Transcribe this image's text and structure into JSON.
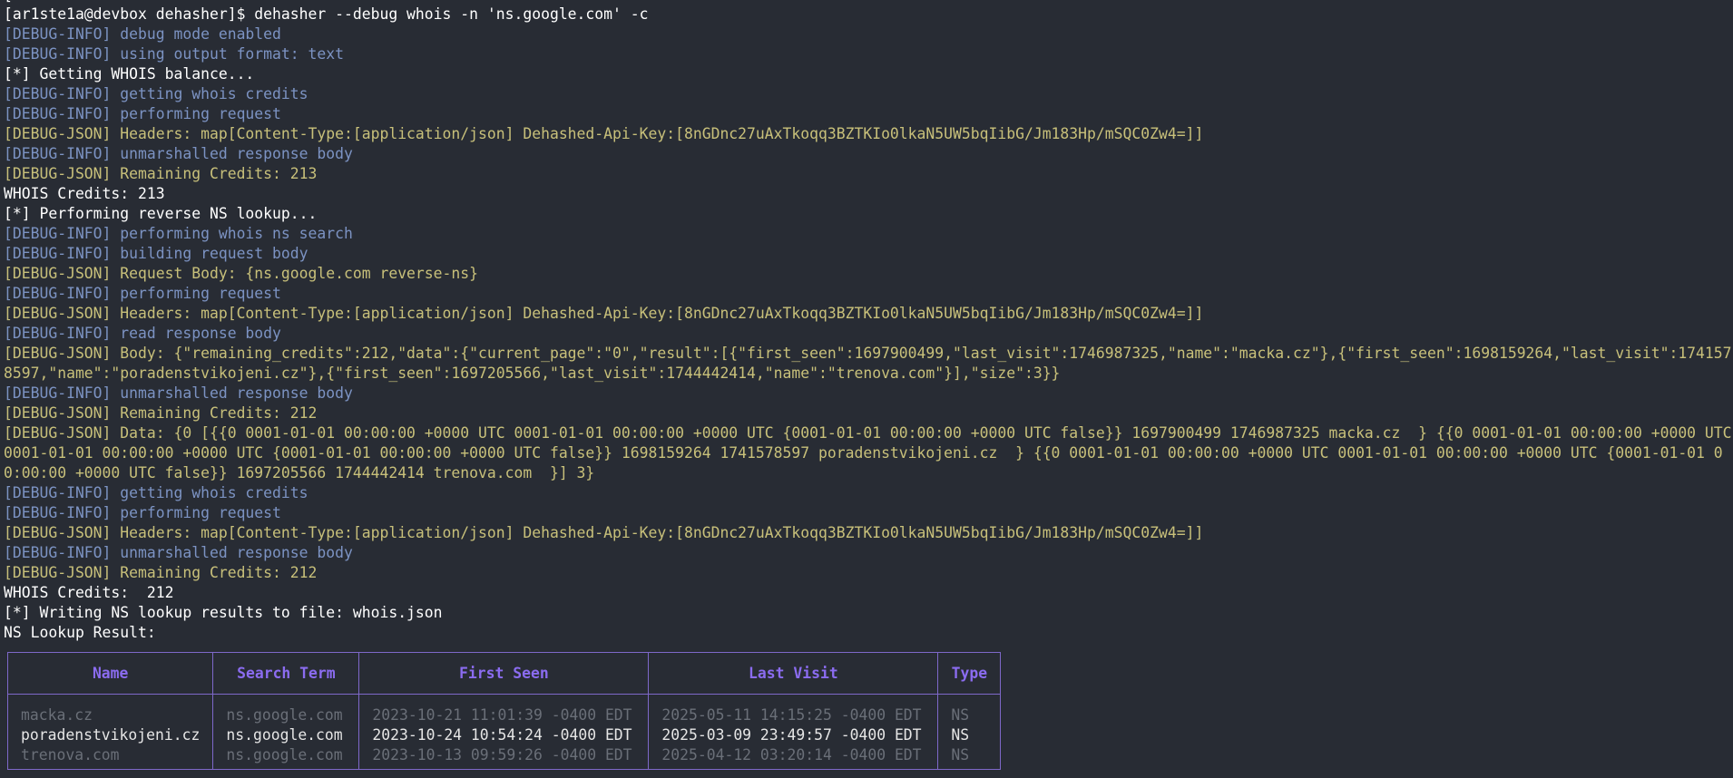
{
  "terminal": {
    "lines": [
      {
        "kind": "prompt",
        "text": "[ar1ste1a@devbox dehasher]$ dehasher --debug whois -n 'ns.google.com' -c"
      },
      {
        "kind": "info",
        "text": "[DEBUG-INFO] debug mode enabled"
      },
      {
        "kind": "info",
        "text": "[DEBUG-INFO] using output format: text"
      },
      {
        "kind": "plain",
        "text": "[*] Getting WHOIS balance..."
      },
      {
        "kind": "info",
        "text": "[DEBUG-INFO] getting whois credits"
      },
      {
        "kind": "info",
        "text": "[DEBUG-INFO] performing request"
      },
      {
        "kind": "json",
        "text": "[DEBUG-JSON] Headers: map[Content-Type:[application/json] Dehashed-Api-Key:[8nGDnc27uAxTkoqq3BZTKIo0lkaN5UW5bqIibG/Jm183Hp/mSQC0Zw4=]]"
      },
      {
        "kind": "info",
        "text": "[DEBUG-INFO] unmarshalled response body"
      },
      {
        "kind": "json",
        "text": "[DEBUG-JSON] Remaining Credits: 213"
      },
      {
        "kind": "plain",
        "text": "WHOIS Credits: 213"
      },
      {
        "kind": "plain",
        "text": "[*] Performing reverse NS lookup..."
      },
      {
        "kind": "info",
        "text": "[DEBUG-INFO] performing whois ns search"
      },
      {
        "kind": "info",
        "text": "[DEBUG-INFO] building request body"
      },
      {
        "kind": "json",
        "text": "[DEBUG-JSON] Request Body: {ns.google.com reverse-ns}"
      },
      {
        "kind": "info",
        "text": "[DEBUG-INFO] performing request"
      },
      {
        "kind": "json",
        "text": "[DEBUG-JSON] Headers: map[Content-Type:[application/json] Dehashed-Api-Key:[8nGDnc27uAxTkoqq3BZTKIo0lkaN5UW5bqIibG/Jm183Hp/mSQC0Zw4=]]"
      },
      {
        "kind": "info",
        "text": "[DEBUG-INFO] read response body"
      },
      {
        "kind": "json",
        "wrap": true,
        "text": "[DEBUG-JSON] Body: {\"remaining_credits\":212,\"data\":{\"current_page\":\"0\",\"result\":[{\"first_seen\":1697900499,\"last_visit\":1746987325,\"name\":\"macka.cz\"},{\"first_seen\":1698159264,\"last_visit\":1741578597,\"name\":\"poradenstvikojeni.cz\"},{\"first_seen\":1697205566,\"last_visit\":1744442414,\"name\":\"trenova.com\"}],\"size\":3}}"
      },
      {
        "kind": "info",
        "text": "[DEBUG-INFO] unmarshalled response body"
      },
      {
        "kind": "json",
        "text": "[DEBUG-JSON] Remaining Credits: 212"
      },
      {
        "kind": "json",
        "wrap": true,
        "text": "[DEBUG-JSON] Data: {0 [{{0 0001-01-01 00:00:00 +0000 UTC 0001-01-01 00:00:00 +0000 UTC {0001-01-01 00:00:00 +0000 UTC false}} 1697900499 1746987325 macka.cz  } {{0 0001-01-01 00:00:00 +0000 UTC 0001-01-01 00:00:00 +0000 UTC {0001-01-01 00:00:00 +0000 UTC false}} 1698159264 1741578597 poradenstvikojeni.cz  } {{0 0001-01-01 00:00:00 +0000 UTC 0001-01-01 00:00:00 +0000 UTC {0001-01-01 00:00:00 +0000 UTC false}} 1697205566 1744442414 trenova.com  }] 3}"
      },
      {
        "kind": "info",
        "text": "[DEBUG-INFO] getting whois credits"
      },
      {
        "kind": "info",
        "text": "[DEBUG-INFO] performing request"
      },
      {
        "kind": "json",
        "text": "[DEBUG-JSON] Headers: map[Content-Type:[application/json] Dehashed-Api-Key:[8nGDnc27uAxTkoqq3BZTKIo0lkaN5UW5bqIibG/Jm183Hp/mSQC0Zw4=]]"
      },
      {
        "kind": "info",
        "text": "[DEBUG-INFO] unmarshalled response body"
      },
      {
        "kind": "json",
        "text": "[DEBUG-JSON] Remaining Credits: 212"
      },
      {
        "kind": "plain",
        "text": "WHOIS Credits:  212"
      },
      {
        "kind": "plain",
        "text": "[*] Writing NS lookup results to file: whois.json"
      },
      {
        "kind": "plain",
        "text": "NS Lookup Result:"
      }
    ]
  },
  "results_table": {
    "headers": {
      "name": "Name",
      "search_term": "Search Term",
      "first_seen": "First Seen",
      "last_visit": "Last Visit",
      "type": "Type"
    },
    "rows": [
      {
        "name": "macka.cz",
        "search_term": "ns.google.com",
        "first_seen": "2023-10-21 11:01:39 -0400 EDT",
        "last_visit": "2025-05-11 14:15:25 -0400 EDT",
        "type": "NS",
        "style": "dim"
      },
      {
        "name": "poradenstvikojeni.cz",
        "search_term": "ns.google.com",
        "first_seen": "2023-10-24 10:54:24 -0400 EDT",
        "last_visit": "2025-03-09 23:49:57 -0400 EDT",
        "type": "NS",
        "style": "bright"
      },
      {
        "name": "trenova.com",
        "search_term": "ns.google.com",
        "first_seen": "2023-10-13 09:59:26 -0400 EDT",
        "last_visit": "2025-04-12 03:20:14 -0400 EDT",
        "type": "NS",
        "style": "dim"
      }
    ]
  },
  "colors": {
    "background": "#282c34",
    "debug_info": "#7c93c3",
    "debug_json": "#c8c07a",
    "plain": "#ffffff",
    "table_border": "#7e68c9",
    "table_header": "#8b6cf0"
  }
}
